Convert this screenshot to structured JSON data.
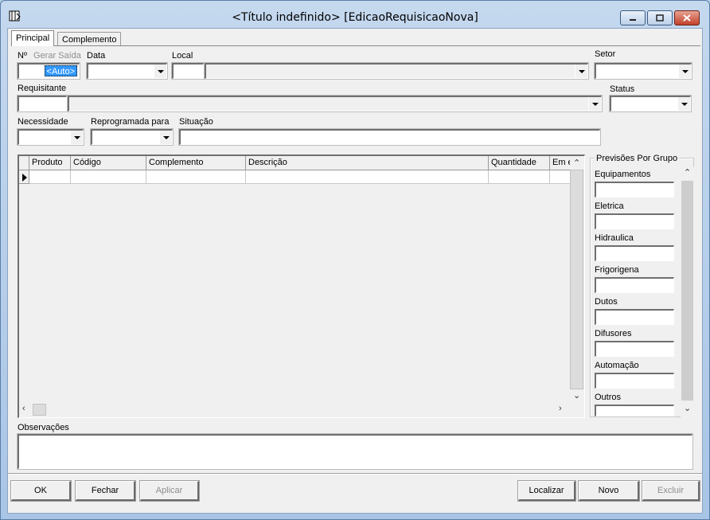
{
  "window": {
    "title": "<Título indefinido> [EdicaoRequisicaoNova]"
  },
  "tabs": [
    {
      "label": "Principal",
      "active": true
    },
    {
      "label": "Complemento",
      "active": false
    }
  ],
  "form": {
    "numero_label": "Nº",
    "gerar_saida_label": "Gerar Saída",
    "auto_value": "<Auto>",
    "data_label": "Data",
    "local_label": "Local",
    "setor_label": "Setor",
    "requisitante_label": "Requisitante",
    "status_label": "Status",
    "necessidade_label": "Necessidade",
    "reprogramada_label": "Reprogramada para",
    "situacao_label": "Situação",
    "observacoes_label": "Observações"
  },
  "grid": {
    "columns": [
      "Produto",
      "Código",
      "Complemento",
      "Descrição",
      "Quantidade",
      "Em e"
    ],
    "rows": []
  },
  "previsoes": {
    "title": "Previsões Por Grupo",
    "groups": [
      "Equipamentos",
      "Eletrica",
      "Hidraulica",
      "Frigorigena",
      "Dutos",
      "Difusores",
      "Automação",
      "Outros"
    ]
  },
  "buttons": {
    "ok": "OK",
    "fechar": "Fechar",
    "aplicar": "Aplicar",
    "localizar": "Localizar",
    "novo": "Novo",
    "excluir": "Excluir"
  }
}
